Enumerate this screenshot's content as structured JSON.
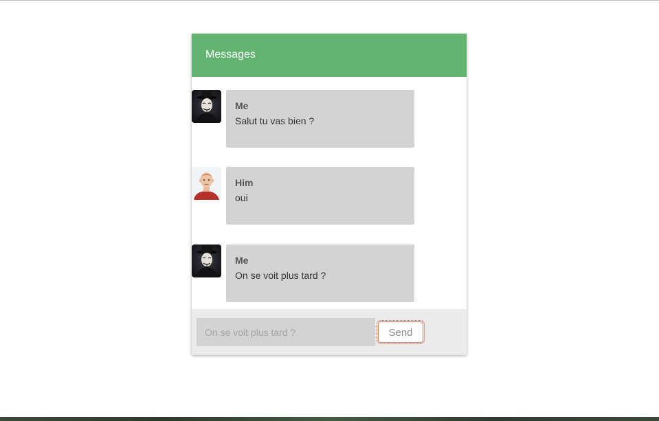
{
  "panel": {
    "title": "Messages"
  },
  "messages": [
    {
      "author": "Me",
      "text": "Salut tu vas bien ?",
      "avatar": "masked-man-avatar"
    },
    {
      "author": "Him",
      "text": "oui",
      "avatar": "boy-avatar"
    },
    {
      "author": "Me",
      "text": "On se voit plus tard ?",
      "avatar": "masked-man-avatar"
    }
  ],
  "composer": {
    "placeholder": "On se voit plus tard ?",
    "send_label": "Send"
  },
  "colors": {
    "header": "#61b36f",
    "bubble": "#d3d3d3",
    "footer": "#ebebeb",
    "send_border": "#d37a63"
  }
}
